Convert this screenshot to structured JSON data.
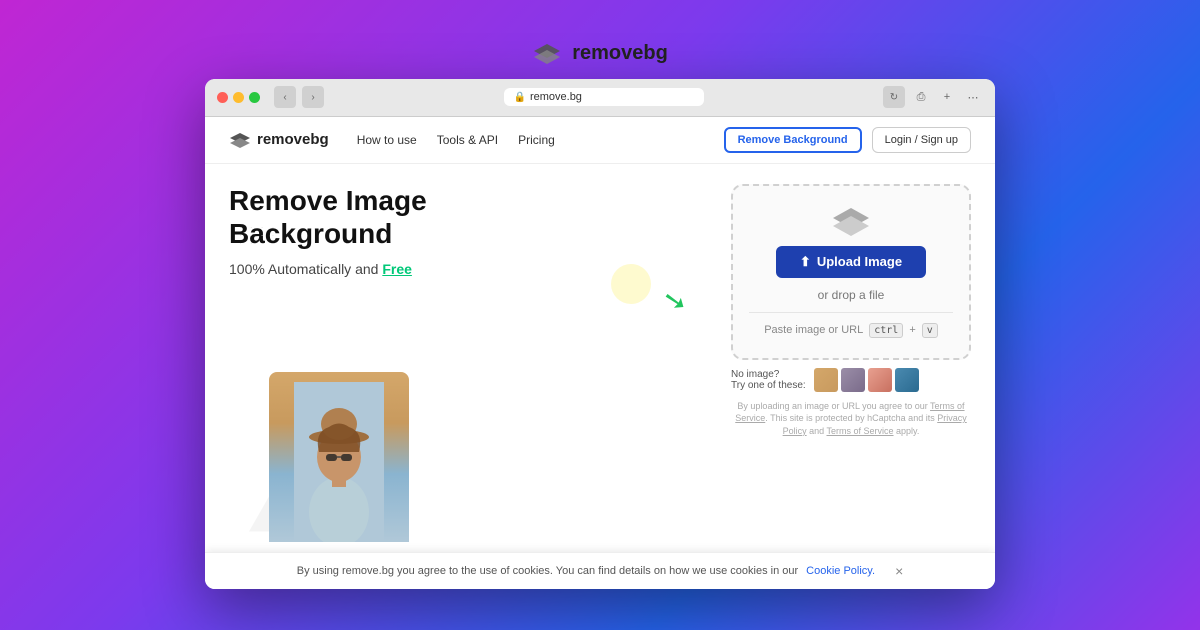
{
  "topBrand": {
    "logoAlt": "removebg logo",
    "name": "removebg",
    "nameBold": "remove",
    "nameSuffix": "bg"
  },
  "browser": {
    "url": "remove.bg",
    "navBack": "‹",
    "navForward": "›",
    "shareIcon": "⎙",
    "addTabIcon": "+",
    "moreIcon": "⋯",
    "reloadIcon": "↻"
  },
  "nav": {
    "logoText": "removebg",
    "links": [
      {
        "label": "How to use"
      },
      {
        "label": "Tools & API"
      },
      {
        "label": "Pricing"
      }
    ],
    "cta": "Remove Background",
    "login": "Login / Sign up"
  },
  "hero": {
    "title": "Remove Image\nBackground",
    "subtitle": "100% Automatically and ",
    "free": "Free"
  },
  "upload": {
    "buttonLabel": "Upload Image",
    "uploadIcon": "⬆",
    "orDrop": "or drop a file",
    "pasteLabel": "Paste image or URL",
    "pasteKbd1": "ctrl",
    "pasteKbd2": "+",
    "pasteKbd3": "v",
    "noImageLabel": "No image?",
    "tryLabel": "Try one of these:"
  },
  "disclaimer": {
    "text": "By uploading an image or URL you agree to our ",
    "termsLink": "Terms of Service",
    "mid": ". This site is protected by hCaptcha and its ",
    "privacyLink": "Privacy Policy",
    "and": " and ",
    "termsLink2": "Terms of Service",
    "end": " apply."
  },
  "cookie": {
    "text": "By using remove.bg you agree to the use of cookies. You can find details on how we use cookies in our ",
    "linkText": "Cookie Policy.",
    "closeBtn": "×"
  }
}
